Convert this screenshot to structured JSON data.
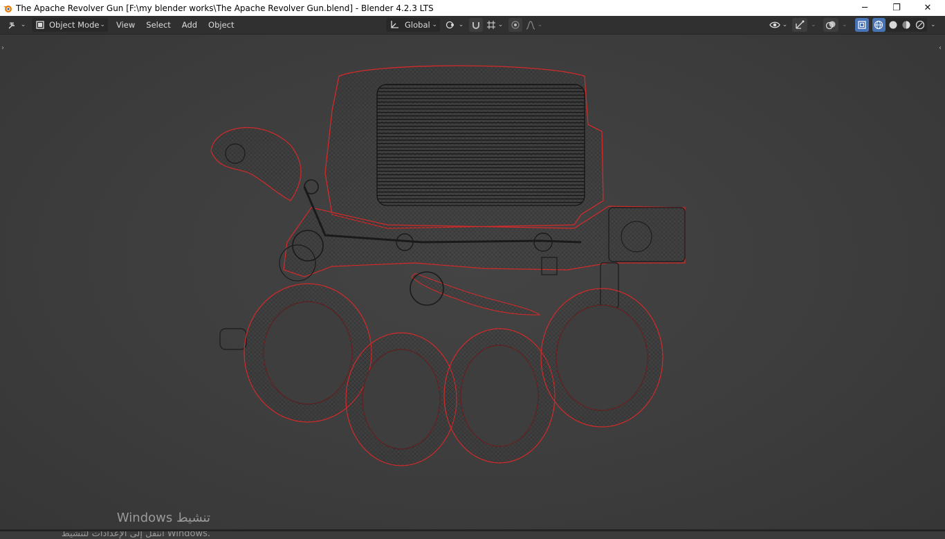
{
  "window": {
    "title": "The Apache Revolver Gun [F:\\my blender works\\The Apache Revolver Gun.blend] - Blender 4.2.3 LTS",
    "app_icon": "blender-icon",
    "controls": {
      "minimize": "─",
      "restore": "❐",
      "close": "✕"
    }
  },
  "header": {
    "editor_type_icon": "editor-type-icon",
    "mode_label": "Object Mode",
    "menus": [
      "View",
      "Select",
      "Add",
      "Object"
    ],
    "transform_orientation": "Global",
    "pivot_icon": "pivot-point-icon",
    "snap_icon": "snap-icon",
    "snap_target_icon": "snap-increment-icon",
    "proportional_icon": "proportional-edit-icon",
    "falloff_icon": "falloff-curve-icon",
    "visibility_icon": "visibility-eye-icon",
    "gizmo_icon": "gizmo-icon",
    "overlay_icon": "overlay-icon",
    "xray_icon": "xray-icon",
    "shading_modes": [
      "wireframe",
      "solid",
      "material-preview",
      "rendered"
    ],
    "active_shading": "wireframe"
  },
  "viewport": {
    "left_toggle": "›",
    "right_toggle": "‹",
    "wire_color": "#1a1a1a",
    "selected_outline_color": "#d42a2a",
    "background_color": "#3d3d3d"
  },
  "watermark": {
    "line1": "Windows تنشيط",
    "line2": "انتقل إلى الإعدادات لتنشيط Windows."
  }
}
